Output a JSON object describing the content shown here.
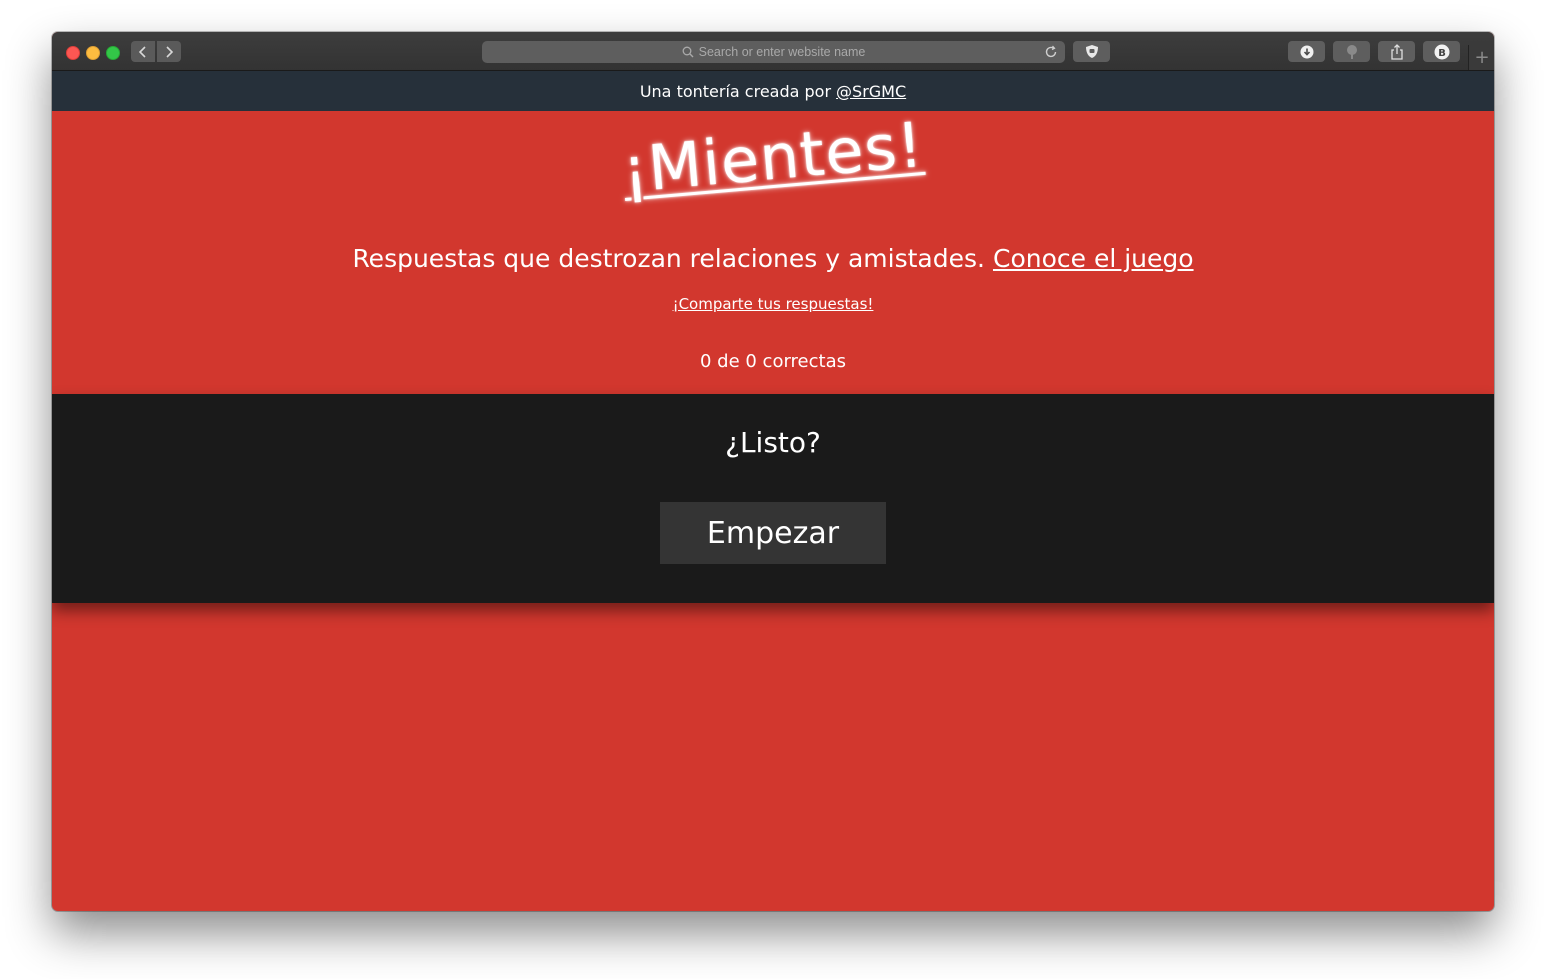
{
  "browser": {
    "address_placeholder": "Search or enter website name",
    "new_tab_label": "+",
    "account_initial": "B"
  },
  "topbar": {
    "text": "Una tontería creada por",
    "link": "@SrGMC"
  },
  "hero": {
    "logo": "¡Mientes!",
    "tagline": "Respuestas que destrozan relaciones y amistades.",
    "tagline_link": "Conoce el juego",
    "share_link": "¡Comparte tus respuestas!",
    "score": "0 de 0 correctas"
  },
  "game": {
    "prompt": "¿Listo?",
    "start_label": "Empezar"
  },
  "colors": {
    "page_red": "#d2372e",
    "topbar_navy": "#26303a",
    "panel_black": "#1a1a1a",
    "button_gray": "#343434"
  }
}
